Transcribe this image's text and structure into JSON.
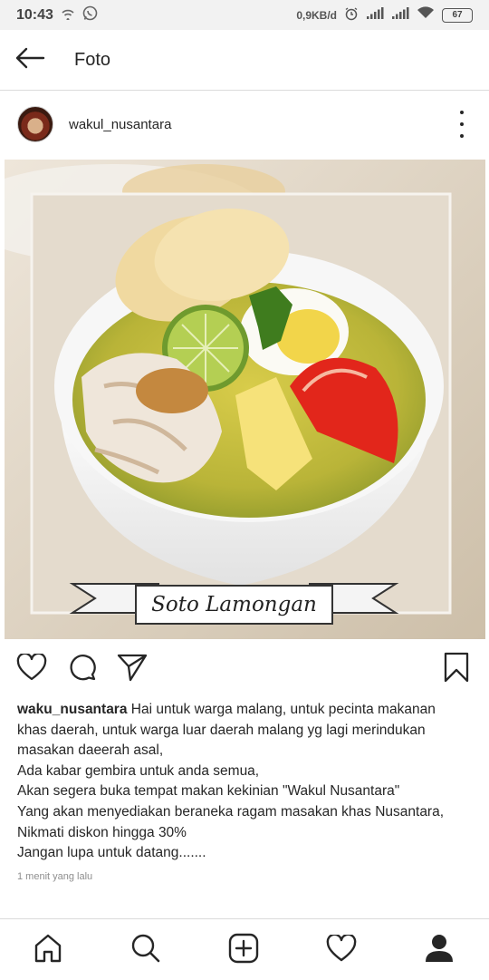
{
  "status_bar": {
    "time": "10:43",
    "network_speed": "0,9KB/d",
    "battery_level": "67",
    "icons": [
      "hotspot-icon",
      "whatsapp-icon",
      "alarm-icon",
      "signal-icon",
      "signal-icon",
      "wifi-icon",
      "battery-icon"
    ]
  },
  "top_bar": {
    "title": "Foto",
    "back_icon": "arrow-left-icon"
  },
  "post": {
    "username": "wakul_nusantara",
    "more_icon": "more-vertical-icon",
    "photo": {
      "banner_text": "Soto Lamongan"
    },
    "actions": {
      "like_icon": "heart-icon",
      "comment_icon": "comment-icon",
      "share_icon": "send-icon",
      "save_icon": "bookmark-icon"
    },
    "caption": {
      "username": "waku_nusantara",
      "lines": [
        " Hai untuk warga malang, untuk pecinta makanan",
        "khas daerah, untuk warga luar daerah malang yg lagi merindukan",
        "masakan daeerah asal,",
        "Ada kabar gembira untuk anda semua,",
        "Akan segera buka tempat makan kekinian \"Wakul Nusantara\"",
        "Yang akan menyediakan beraneka ragam masakan khas Nusantara,",
        "Nikmati diskon hingga 30%",
        "Jangan lupa untuk datang......."
      ]
    },
    "timestamp": "1 menit yang lalu"
  },
  "bottom_nav": {
    "items": [
      "home-icon",
      "search-icon",
      "add-post-icon",
      "activity-heart-icon",
      "profile-icon"
    ]
  },
  "colors": {
    "text": "#262626",
    "muted": "#8e8e8e",
    "divider": "#dbdbdb",
    "status_bar_bg": "#f2f2f2"
  }
}
